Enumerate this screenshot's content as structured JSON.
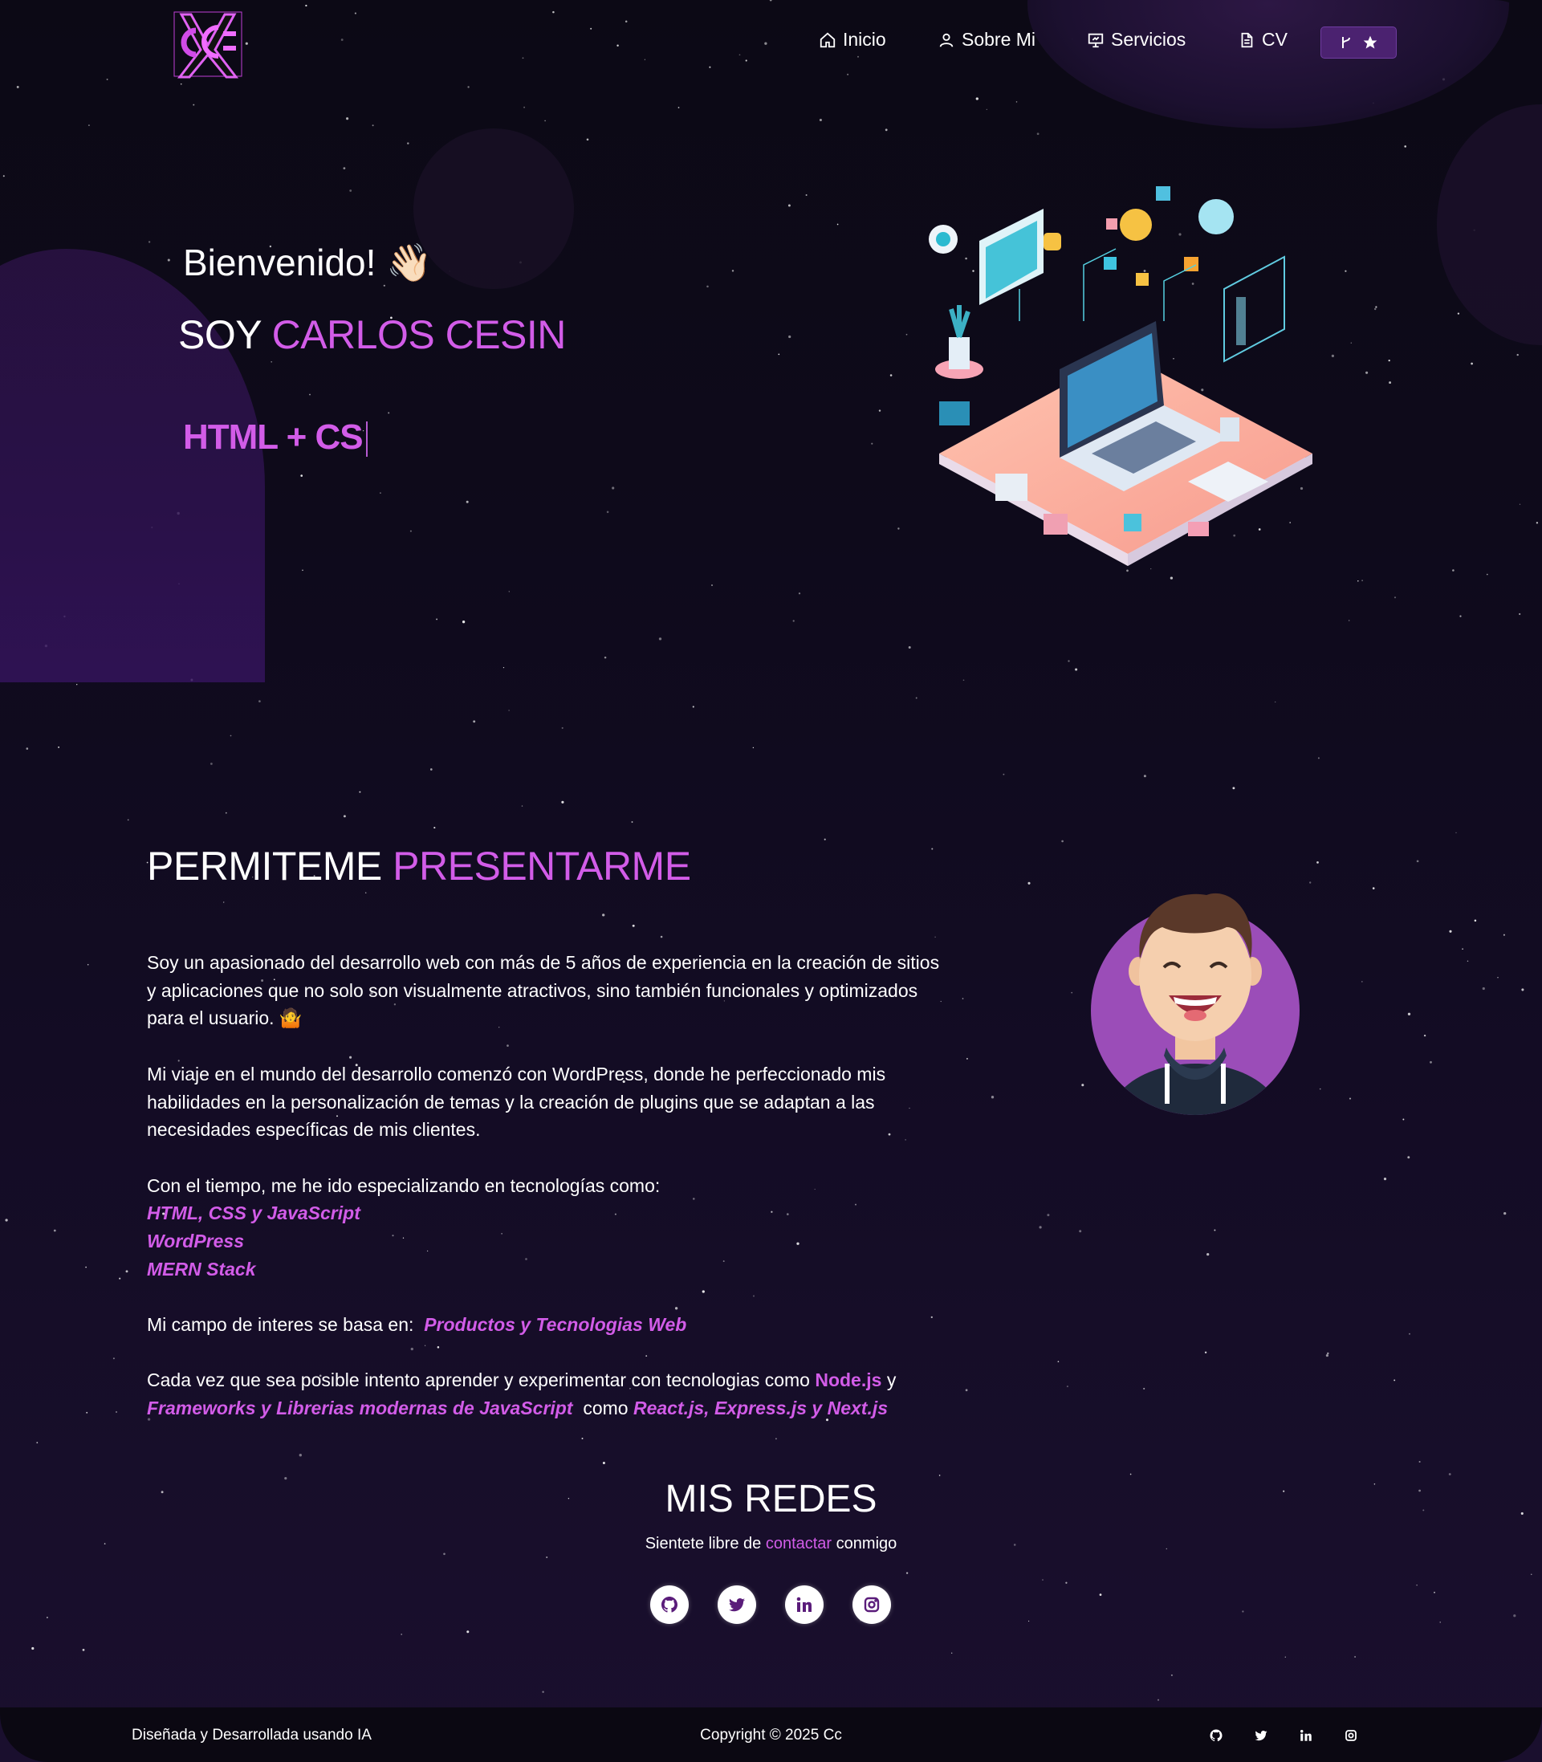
{
  "nav": {
    "items": [
      {
        "label": "Inicio",
        "icon": "home-icon"
      },
      {
        "label": "Sobre Mi",
        "icon": "user-icon"
      },
      {
        "label": "Servicios",
        "icon": "presentation-icon"
      },
      {
        "label": "CV",
        "icon": "document-icon"
      }
    ],
    "github_button_icons": [
      "git-fork-icon",
      "star-icon"
    ]
  },
  "hero": {
    "greeting": "Bienvenido!",
    "greeting_emoji": "👋🏻",
    "soy": "SOY",
    "name": "CARLOS CESIN",
    "typed_text": "HTML + CS"
  },
  "about": {
    "title_white": "PERMITEME",
    "title_accent": "PRESENTARME",
    "p1": "Soy un apasionado del desarrollo web con más de 5 años de experiencia en la creación de sitios y aplicaciones que no solo son visualmente atractivos, sino también funcionales y optimizados para el usuario. 🤷",
    "p2": "Mi viaje en el mundo del desarrollo comenzó con WordPress, donde he perfeccionado mis habilidades en la personalización de temas y la creación de plugins que se adaptan a las necesidades específicas de mis clientes.",
    "p3_intro": "Con el tiempo, me he ido especializando en tecnologías como:",
    "techs": [
      "HTML, CSS y JavaScript",
      "WordPress",
      "MERN Stack"
    ],
    "interest_label": "Mi campo de interes se basa en:",
    "interest_value": "Productos y Tecnologias Web",
    "learn_prefix": "Cada vez que sea posible intento aprender y experimentar con tecnologias como",
    "learn_node": "Node.js",
    "learn_y": "y",
    "learn_frameworks": "Frameworks y Librerias modernas de JavaScript",
    "learn_como": "como",
    "learn_libs": "React.js, Express.js y Next.js"
  },
  "redes": {
    "title": "MIS REDES",
    "sub_prefix": "Sientete libre de",
    "sub_link": "contactar",
    "sub_suffix": "conmigo",
    "icons": [
      "github-icon",
      "twitter-icon",
      "linkedin-icon",
      "instagram-icon"
    ]
  },
  "footer": {
    "left": "Diseñada y Desarrollada usando IA",
    "center": "Copyright © 2025 Cc"
  },
  "colors": {
    "accent": "#d25ce8",
    "background": "#0e0a1b",
    "avatar_circle": "#9b4db8"
  }
}
